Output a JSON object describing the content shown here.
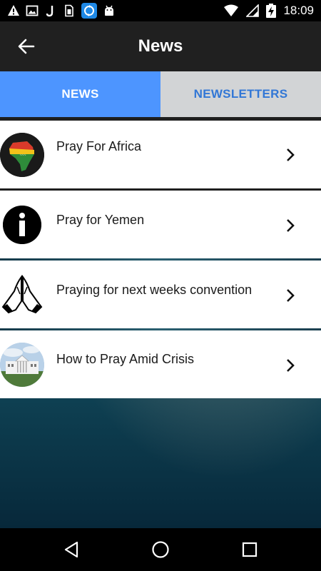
{
  "status_bar": {
    "time": "18:09",
    "left_icons": [
      "warning-icon",
      "image-icon",
      "j-app-icon",
      "sim-card-icon",
      "sync-app-icon",
      "android-icon"
    ],
    "right_icons": [
      "wifi-icon",
      "signal-icon",
      "battery-charging-icon"
    ]
  },
  "app_bar": {
    "title": "News",
    "back_icon": "arrow-left-icon"
  },
  "tabs": [
    {
      "label": "NEWS",
      "active": true
    },
    {
      "label": "NEWSLETTERS",
      "active": false
    }
  ],
  "news_items": [
    {
      "title": "Pray For Africa",
      "thumbnail": "africa-map-icon"
    },
    {
      "title": "Pray for Yemen",
      "thumbnail": "info-icon"
    },
    {
      "title": "Praying for next weeks convention",
      "thumbnail": "praying-hands-icon"
    },
    {
      "title": "How to Pray Amid Crisis",
      "thumbnail": "white-house-image"
    }
  ],
  "nav_bar": {
    "buttons": [
      "back-triangle-icon",
      "home-circle-icon",
      "recents-square-icon"
    ]
  },
  "colors": {
    "app_bar": "#202020",
    "tab_active": "#4d95ff",
    "tab_inactive": "#d2d4d6",
    "tab_inactive_text": "#3277d6"
  }
}
